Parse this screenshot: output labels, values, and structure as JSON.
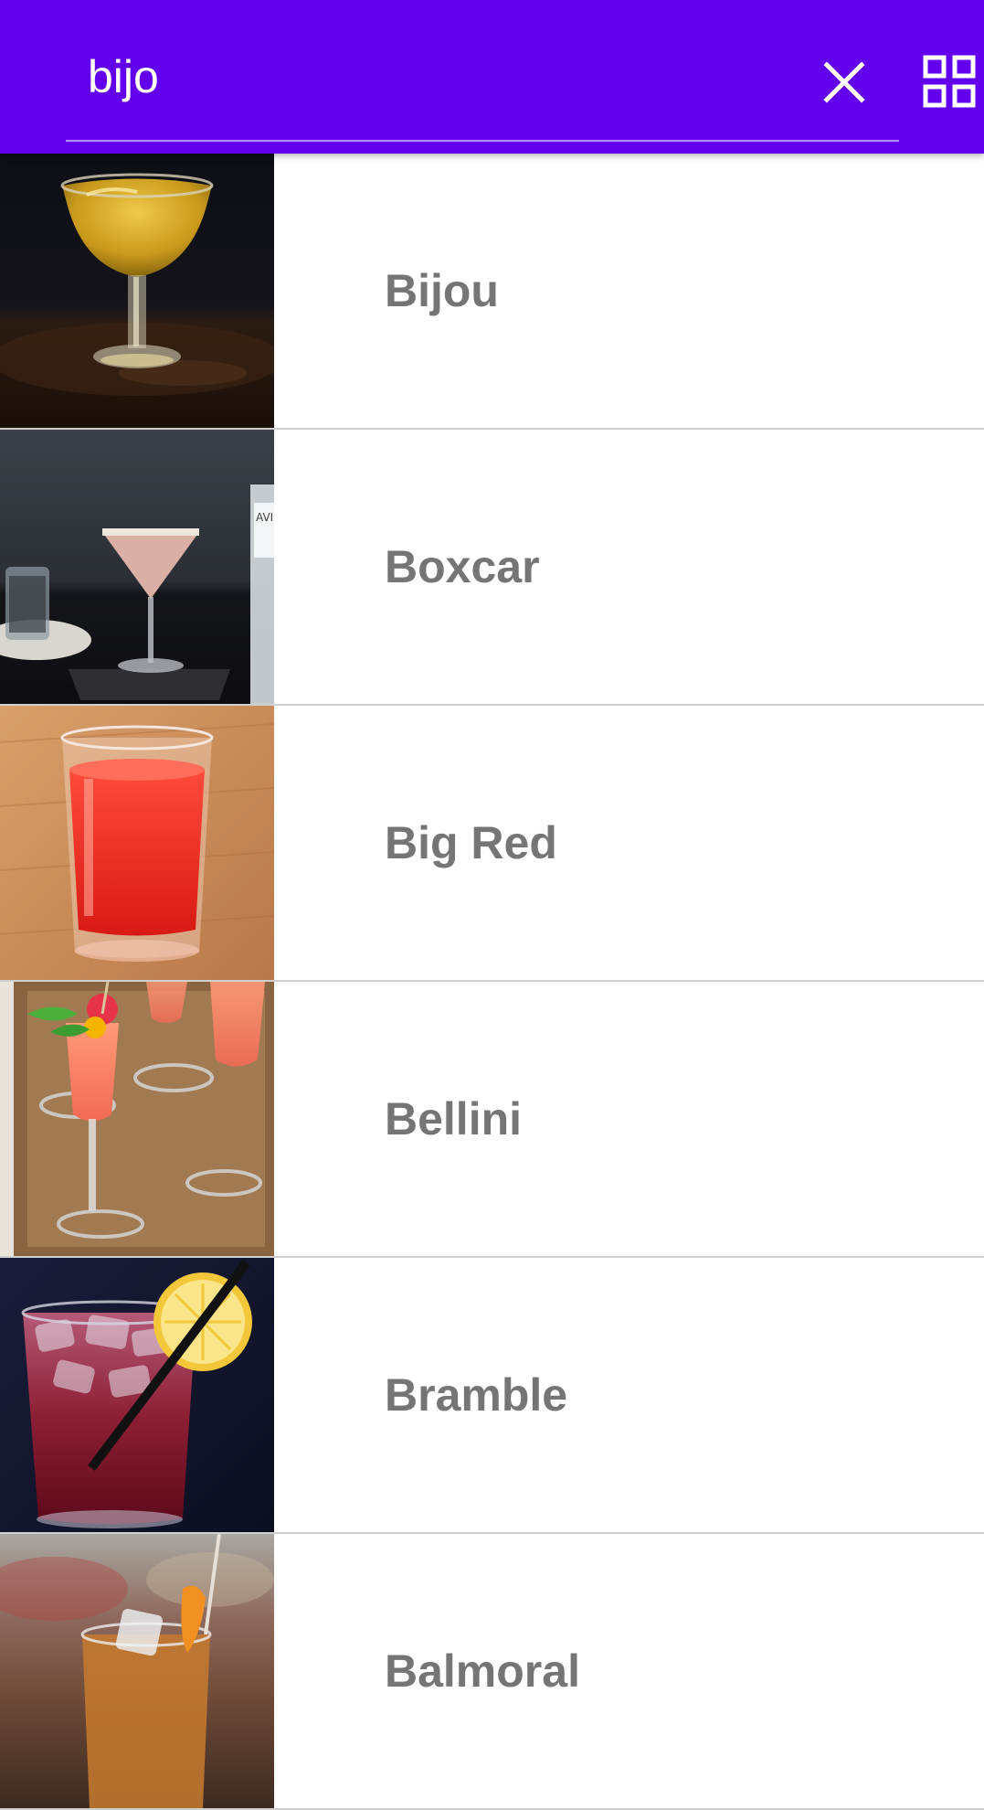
{
  "search": {
    "value": "bijo",
    "accent": "#6200EE"
  },
  "toolbar": {
    "clear_icon": "close-icon",
    "view_icon": "grid-view-icon"
  },
  "results": [
    {
      "name": "Bijou",
      "thumbnail": "coupe glass with amber cocktail on dark background"
    },
    {
      "name": "Boxcar",
      "thumbnail": "martini glass with pink foamy cocktail"
    },
    {
      "name": "Big Red",
      "thumbnail": "shot glass with red drink on wooden board"
    },
    {
      "name": "Bellini",
      "thumbnail": "champagne flutes with peach drink and garnish on tray"
    },
    {
      "name": "Bramble",
      "thumbnail": "rocks glass with berry drink, lemon slice and straw"
    },
    {
      "name": "Balmoral",
      "thumbnail": "rocks glass with ice and orange peel"
    }
  ]
}
